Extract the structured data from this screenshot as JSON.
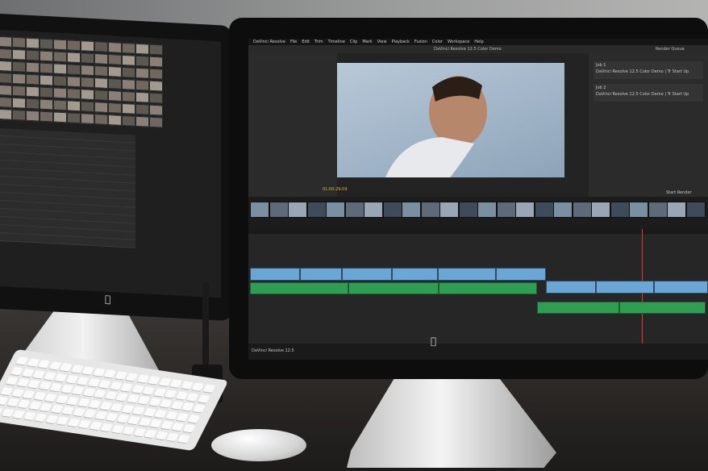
{
  "app": {
    "title": "DaVinci Resolve 12.5 Color Demo",
    "menu": [
      "DaVinci Resolve",
      "File",
      "Edit",
      "Trim",
      "Timeline",
      "Clip",
      "Mark",
      "View",
      "Playback",
      "Fusion",
      "Color",
      "Workspace",
      "Help"
    ],
    "render_queue": "Render Queue",
    "jobs": [
      "Job 1",
      "Job 2"
    ],
    "job_names": [
      "DaVinci Resolve 12.5 Color Demo | Tr Start Up",
      "DaVinci Resolve 12.5 Color Demo | Tr Start Up"
    ],
    "timecode": "01:00:29:09",
    "start_render": "Start Render",
    "status_label": "DaVinci Resolve 12.5"
  },
  "icons": {
    "apple_logo": "apple-logo-icon"
  },
  "colors": {
    "video_clip": "#6aa6d6",
    "audio_clip": "#2f9e52",
    "ui_bg": "#232324"
  }
}
